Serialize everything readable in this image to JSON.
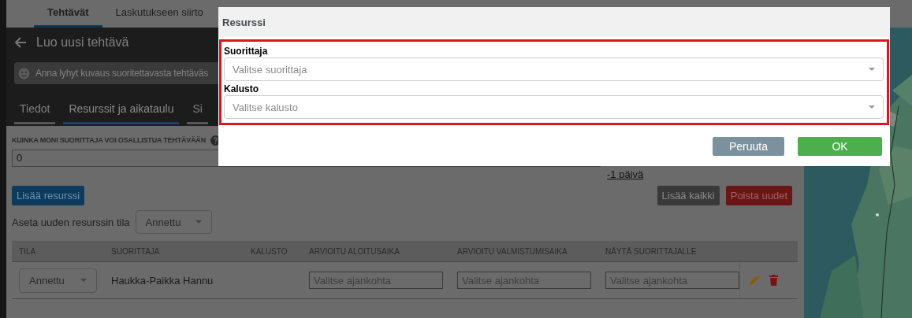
{
  "top_tabs": [
    {
      "label": "Tehtävät",
      "selected": true
    },
    {
      "label": "Laskutukseen siirto",
      "selected": false
    }
  ],
  "header": {
    "title": "Luo uusi tehtävä",
    "description_placeholder": "Anna lyhyt kuvaus suoritettavasta tehtäväs"
  },
  "sub_tabs": [
    {
      "label": "Tiedot",
      "selected": false
    },
    {
      "label": "Resurssit ja aikataulu",
      "selected": true
    },
    {
      "label": "Si",
      "selected": false
    }
  ],
  "participants": {
    "label": "KUINKA MONI SUORITTAJA VOI OSALLISTUA TEHTÄVÄÄN",
    "value": "0"
  },
  "day_link": "-1 päivä",
  "add_resource_button": "Lisää resurssi",
  "add_all_button": "Lisää kaikki",
  "remove_new_button": "Poista uudet",
  "new_resource_state": {
    "label": "Aseta uuden resurssin tila",
    "value": "Annettu"
  },
  "table": {
    "columns": [
      "TILA",
      "SUORITTAJA",
      "KALUSTO",
      "ARVIOITU ALOITUSAIKA",
      "ARVIOITU VALMISTUMISAIKA",
      "NÄYTÄ SUORITTAJALLE"
    ],
    "rows": [
      {
        "state": "Annettu",
        "performer": "Haukka-Paikka Hannu",
        "start_placeholder": "Valitse ajankohta",
        "end_placeholder": "Valitse ajankohta",
        "show_placeholder": "Valitse ajankohta"
      }
    ]
  },
  "dialog": {
    "title": "Resurssi",
    "fields": [
      {
        "label": "Suorittaja",
        "placeholder": "Valitse suorittaja"
      },
      {
        "label": "Kalusto",
        "placeholder": "Valitse kalusto"
      }
    ],
    "buttons": [
      {
        "label": "Peruuta",
        "kind": "cancel"
      },
      {
        "label": "OK",
        "kind": "ok"
      }
    ]
  }
}
